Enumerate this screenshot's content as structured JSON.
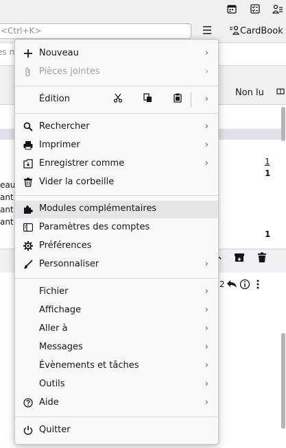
{
  "toolbar": {
    "calendar_icon": "calendar-icon",
    "tasks_icon": "tasks-icon",
    "address_icon": "address-book-icon",
    "search_placeholder": "<Ctrl+K>",
    "cardbook_label": "CardBook"
  },
  "filter": {
    "placeholder_fragment": "es m"
  },
  "thread_header": {
    "unread_label": "Non lu"
  },
  "thread_fragments": {
    "row1_count_link": "1",
    "row2_count": "1",
    "row3_count": "1",
    "left_texts": [
      "eau",
      "ant",
      "ant",
      "ant"
    ]
  },
  "preview": {
    "count_fragment": "2"
  },
  "menu": {
    "items": [
      {
        "label": "Nouveau",
        "icon": "plus-icon",
        "submenu": true
      },
      {
        "label": "Pièces jointes",
        "icon": "paperclip-icon",
        "submenu": true,
        "disabled": true
      },
      {
        "label": "Édition",
        "submenu": true
      },
      {
        "label": "Rechercher",
        "icon": "search-icon",
        "submenu": true
      },
      {
        "label": "Imprimer",
        "icon": "printer-icon",
        "submenu": true
      },
      {
        "label": "Enregistrer comme",
        "icon": "save-icon",
        "submenu": true
      },
      {
        "label": "Vider la corbeille",
        "icon": "trash-icon",
        "submenu": false
      },
      {
        "label": "Modules complémentaires",
        "icon": "puzzle-icon",
        "submenu": false
      },
      {
        "label": "Paramètres des comptes",
        "icon": "account-settings-icon",
        "submenu": false
      },
      {
        "label": "Préférences",
        "icon": "gear-icon",
        "submenu": false
      },
      {
        "label": "Personnaliser",
        "icon": "brush-icon",
        "submenu": true
      },
      {
        "label": "Fichier",
        "submenu": true
      },
      {
        "label": "Affichage",
        "submenu": true
      },
      {
        "label": "Aller à",
        "submenu": true
      },
      {
        "label": "Messages",
        "submenu": true
      },
      {
        "label": "Évènements et tâches",
        "submenu": true
      },
      {
        "label": "Outils",
        "submenu": true
      },
      {
        "label": "Aide",
        "icon": "help-icon",
        "submenu": true
      },
      {
        "label": "Quitter",
        "icon": "power-icon",
        "submenu": false
      }
    ],
    "edit_buttons": [
      "cut-icon",
      "copy-icon",
      "paste-icon"
    ]
  }
}
